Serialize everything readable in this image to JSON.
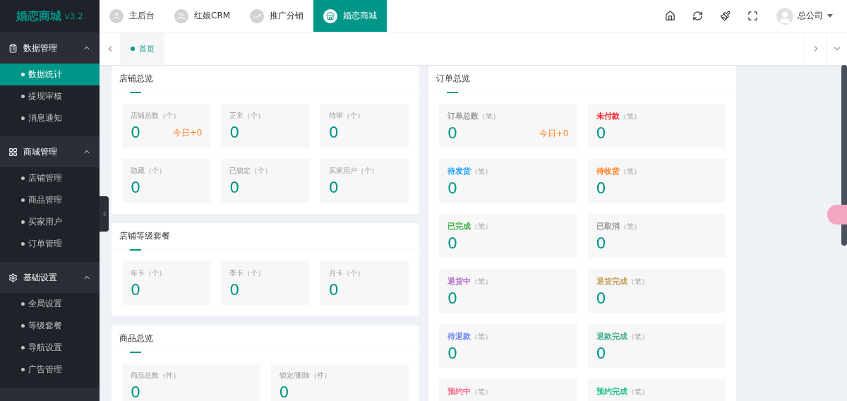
{
  "brand": {
    "name": "婚恋商城",
    "version": "v3.2"
  },
  "sidebar": {
    "sections": [
      {
        "title": "数据管理",
        "kind": "data",
        "expanded": true,
        "items": [
          {
            "label": "数据统计",
            "selected": true
          },
          {
            "label": "提现审核",
            "selected": false
          },
          {
            "label": "消息通知",
            "selected": false
          }
        ]
      },
      {
        "title": "商城管理",
        "kind": "shop",
        "expanded": true,
        "items": [
          {
            "label": "店铺管理",
            "selected": false
          },
          {
            "label": "商品管理",
            "selected": false
          },
          {
            "label": "买家用户",
            "selected": false
          },
          {
            "label": "订单管理",
            "selected": false
          }
        ]
      },
      {
        "title": "基础设置",
        "kind": "settings",
        "expanded": true,
        "items": [
          {
            "label": "全局设置",
            "selected": false
          },
          {
            "label": "等级套餐",
            "selected": false
          },
          {
            "label": "导航设置",
            "selected": false
          },
          {
            "label": "广告管理",
            "selected": false
          }
        ]
      }
    ]
  },
  "top_tabs": [
    {
      "label": "主后台",
      "kind": "user",
      "selected": false
    },
    {
      "label": "红娘CRM",
      "kind": "crm",
      "selected": false
    },
    {
      "label": "推广分销",
      "kind": "chart",
      "selected": false
    },
    {
      "label": "婚恋商城",
      "kind": "store",
      "selected": true
    }
  ],
  "user": {
    "name": "总公司"
  },
  "page_tabs": [
    {
      "label": "首页",
      "selected": true
    }
  ],
  "left_cards": [
    {
      "title": "店铺总览",
      "stats": [
        {
          "label": "店铺总数",
          "unit": "（个）",
          "value": "0",
          "today": "今日+0"
        },
        {
          "label": "正常",
          "unit": "（个）",
          "value": "0"
        },
        {
          "label": "待审",
          "unit": "（个）",
          "value": "0"
        },
        {
          "label": "隐藏",
          "unit": "（个）",
          "value": "0"
        },
        {
          "label": "已锁定",
          "unit": "（个）",
          "value": "0"
        },
        {
          "label": "买家用户",
          "unit": "（个）",
          "value": "0"
        }
      ]
    },
    {
      "title": "店铺等级套餐",
      "stats": [
        {
          "label": "年卡",
          "unit": "（个）",
          "value": "0"
        },
        {
          "label": "季卡",
          "unit": "（个）",
          "value": "0"
        },
        {
          "label": "月卡",
          "unit": "（个）",
          "value": "0"
        }
      ]
    },
    {
      "title": "商品总览",
      "stats": [
        {
          "label": "商品总数",
          "unit": "（件）",
          "value": "0"
        },
        {
          "label": "锁定/删除",
          "unit": "（件）",
          "value": "0"
        }
      ]
    }
  ],
  "right_cards": [
    {
      "title": "订单总览",
      "stats": [
        {
          "label": "订单总数",
          "unit": "（笔）",
          "value": "0",
          "today": "今日+0",
          "color": "#999999"
        },
        {
          "label": "未付款",
          "unit": "（笔）",
          "value": "0",
          "color": "#f5222d"
        },
        {
          "label": "待发货",
          "unit": "（笔）",
          "value": "0",
          "color": "#1e9fff"
        },
        {
          "label": "待收货",
          "unit": "（笔）",
          "value": "0",
          "color": "#ff7d1a"
        },
        {
          "label": "已完成",
          "unit": "（笔）",
          "value": "0",
          "color": "#3cb043"
        },
        {
          "label": "已取消",
          "unit": "（笔）",
          "value": "0",
          "color": "#999999"
        },
        {
          "label": "退货中",
          "unit": "（笔）",
          "value": "0",
          "color": "#b06cc6"
        },
        {
          "label": "退货完成",
          "unit": "（笔）",
          "value": "0",
          "color": "#c2a05a"
        },
        {
          "label": "待退款",
          "unit": "（笔）",
          "value": "0",
          "color": "#6b86f0"
        },
        {
          "label": "退款完成",
          "unit": "（笔）",
          "value": "0",
          "color": "#3fae91"
        },
        {
          "label": "预约中",
          "unit": "（笔）",
          "color": "#f06b8c"
        },
        {
          "label": "预约完成",
          "unit": "（笔）",
          "color": "#22c08a"
        }
      ]
    }
  ]
}
